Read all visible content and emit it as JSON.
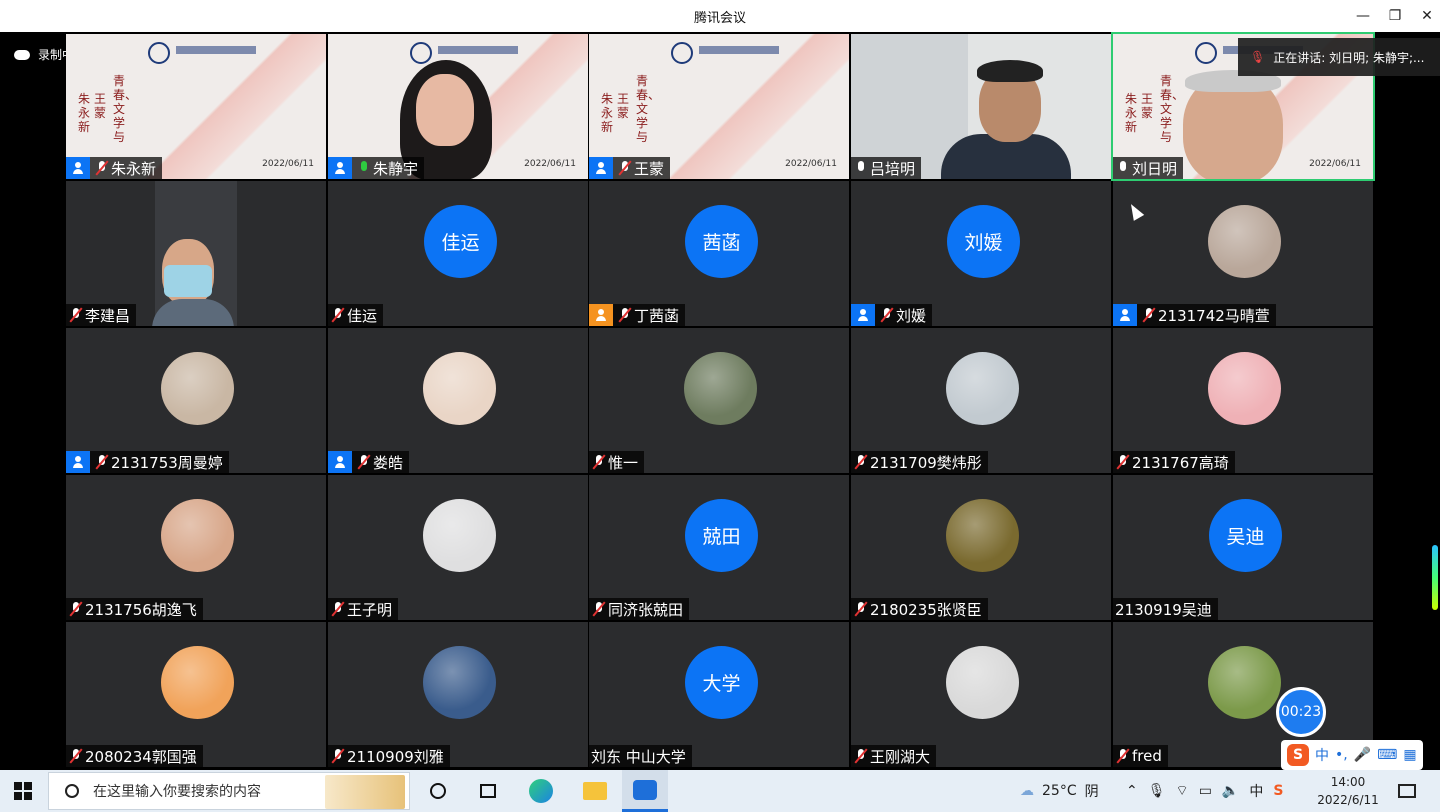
{
  "window": {
    "title": "腾讯会议"
  },
  "recording": {
    "label": "录制中"
  },
  "speaking": {
    "label": "正在讲话: 刘日明; 朱静宇;..."
  },
  "slide_texts": {
    "col1": "青春、文学与",
    "col2": "王蒙",
    "col3": "朱永新",
    "date": "2022/06/11"
  },
  "tiles": [
    {
      "name": "朱永新",
      "kind": "slide",
      "host": true,
      "mic": "muted"
    },
    {
      "name": "朱静宇",
      "kind": "woman",
      "host": true,
      "mic": "on"
    },
    {
      "name": "王蒙",
      "kind": "slide",
      "host": true,
      "mic": "muted"
    },
    {
      "name": "吕培明",
      "kind": "man1",
      "host": false,
      "mic": "unmuted"
    },
    {
      "name": "刘日明",
      "kind": "man2",
      "host": false,
      "mic": "unmuted"
    },
    {
      "name": "李建昌",
      "kind": "masked",
      "host": false,
      "mic": "muted"
    },
    {
      "name": "佳运",
      "kind": "avatar",
      "avatar_text": "佳运",
      "host": false,
      "mic": "muted"
    },
    {
      "name": "丁茜菡",
      "kind": "avatar",
      "avatar_text": "茜菡",
      "host": "orange",
      "mic": "muted"
    },
    {
      "name": "刘媛",
      "kind": "avatar",
      "avatar_text": "刘媛",
      "host": true,
      "mic": "muted"
    },
    {
      "name": "2131742马晴萱",
      "kind": "photo",
      "color": "#b9a79a",
      "host": true,
      "mic": "muted"
    },
    {
      "name": "2131753周曼婷",
      "kind": "photo",
      "color": "#c9b7a4",
      "host": true,
      "mic": "muted"
    },
    {
      "name": "娄皓",
      "kind": "photo",
      "color": "#e9d5c6",
      "host": true,
      "mic": "muted"
    },
    {
      "name": "惟一",
      "kind": "photo",
      "color": "#6e7c5f",
      "host": false,
      "mic": "muted"
    },
    {
      "name": "2131709樊炜彤",
      "kind": "photo",
      "color": "#c2cad0",
      "host": false,
      "mic": "muted"
    },
    {
      "name": "2131767高琦",
      "kind": "photo",
      "color": "#efb1b6",
      "host": false,
      "mic": "muted"
    },
    {
      "name": "2131756胡逸飞",
      "kind": "photo",
      "color": "#d8a78a",
      "host": false,
      "mic": "muted"
    },
    {
      "name": "王子明",
      "kind": "photo",
      "color": "#dfdfe0",
      "host": false,
      "mic": "muted"
    },
    {
      "name": "同济张兢田",
      "kind": "avatar",
      "avatar_text": "兢田",
      "host": false,
      "mic": "muted"
    },
    {
      "name": "2180235张贤臣",
      "kind": "photo",
      "color": "#7a6a2f",
      "host": false,
      "mic": "muted"
    },
    {
      "name": "2130919吴迪",
      "kind": "avatar",
      "avatar_text": "吴迪",
      "host": false,
      "mic": "none"
    },
    {
      "name": "2080234郭国强",
      "kind": "photo",
      "color": "#f1a35a",
      "host": false,
      "mic": "muted"
    },
    {
      "name": "2110909刘雅",
      "kind": "photo",
      "color": "#3a5c8c",
      "host": false,
      "mic": "muted"
    },
    {
      "name": "刘东 中山大学",
      "kind": "avatar",
      "avatar_text": "大学",
      "host": false,
      "mic": "none"
    },
    {
      "name": "王刚湖大",
      "kind": "photo",
      "color": "#d9d9d9",
      "host": false,
      "mic": "muted"
    },
    {
      "name": "fred",
      "kind": "photo",
      "color": "#7c9a4a",
      "host": false,
      "mic": "muted"
    }
  ],
  "timer": {
    "value": "00:23"
  },
  "ime": {
    "mode": "中",
    "punct": "•,"
  },
  "taskbar": {
    "search_placeholder": "在这里输入你要搜索的内容",
    "weather_temp": "25°C",
    "weather_desc": "阴",
    "ime_indicator": "中",
    "time": "14:00",
    "date": "2022/6/11"
  },
  "colors": {
    "accent": "#0c74f5",
    "tile_bg": "#2b2c2e",
    "muted_red": "#e13333"
  }
}
